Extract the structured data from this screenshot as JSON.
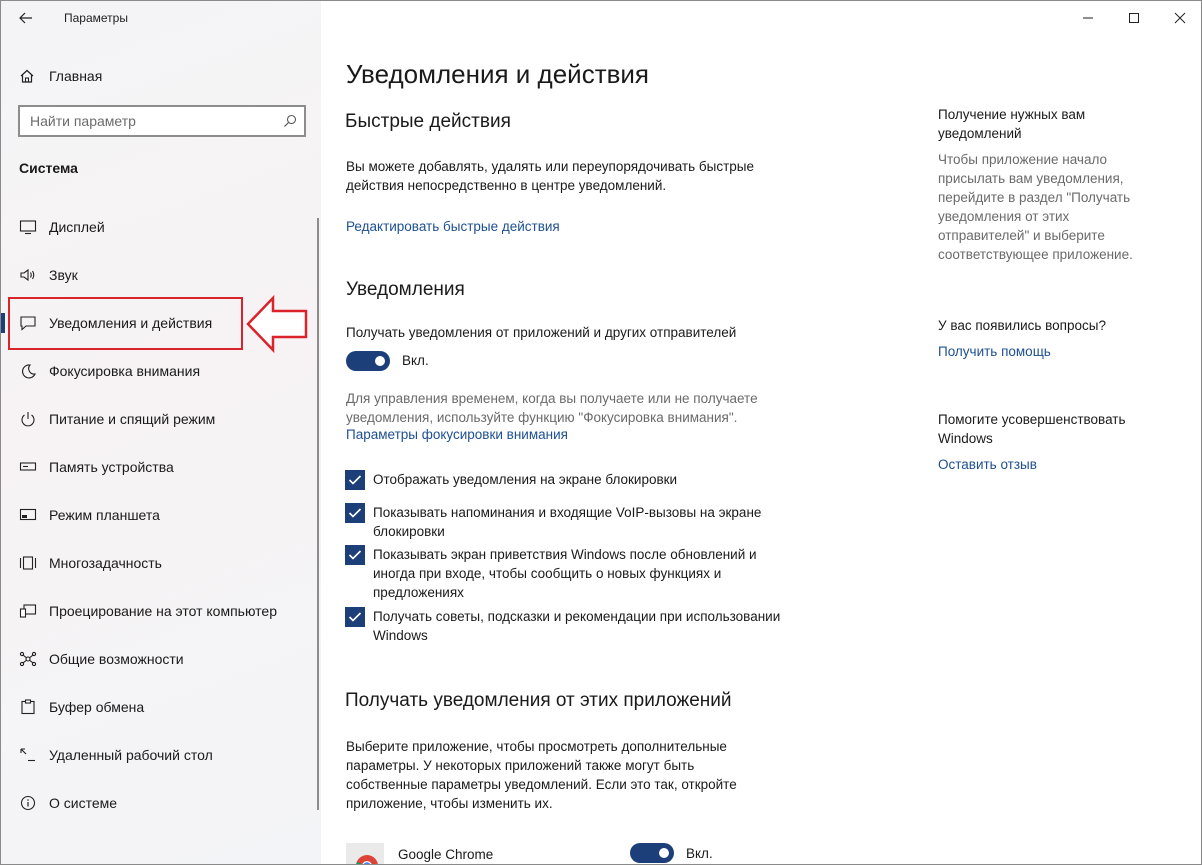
{
  "app": {
    "title": "Параметры"
  },
  "sidebar": {
    "home_label": "Главная",
    "search_placeholder": "Найти параметр",
    "section": "Система",
    "items": [
      {
        "label": "Дисплей",
        "icon": "monitor-icon"
      },
      {
        "label": "Звук",
        "icon": "speaker-icon"
      },
      {
        "label": "Уведомления и действия",
        "icon": "notification-icon",
        "active": true
      },
      {
        "label": "Фокусировка внимания",
        "icon": "moon-icon"
      },
      {
        "label": "Питание и спящий режим",
        "icon": "power-icon"
      },
      {
        "label": "Память устройства",
        "icon": "storage-icon"
      },
      {
        "label": "Режим планшета",
        "icon": "tablet-icon"
      },
      {
        "label": "Многозадачность",
        "icon": "multitask-icon"
      },
      {
        "label": "Проецирование на этот компьютер",
        "icon": "project-icon"
      },
      {
        "label": "Общие возможности",
        "icon": "shared-icon"
      },
      {
        "label": "Буфер обмена",
        "icon": "clipboard-icon"
      },
      {
        "label": "Удаленный рабочий стол",
        "icon": "remote-desktop-icon"
      },
      {
        "label": "О системе",
        "icon": "info-icon"
      }
    ]
  },
  "main": {
    "title": "Уведомления и действия",
    "quick": {
      "heading": "Быстрые действия",
      "desc": "Вы можете добавлять, удалять или переупорядочивать быстрые действия непосредственно в центре уведомлений.",
      "link": "Редактировать быстрые действия"
    },
    "notifications": {
      "heading": "Уведомления",
      "toggle_label": "Получать уведомления от приложений и других отправителей",
      "toggle_state": "Вкл.",
      "focus_desc": "Для управления временем, когда вы получаете или не получаете уведомления, используйте функцию \"Фокусировка внимания\".",
      "focus_link": "Параметры фокусировки внимания",
      "checkboxes": [
        "Отображать уведомления на экране блокировки",
        "Показывать напоминания и входящие VoIP-вызовы на экране блокировки",
        "Показывать экран приветствия Windows после обновлений и иногда при входе, чтобы сообщить о новых функциях и предложениях",
        "Получать советы, подсказки и рекомендации при использовании Windows"
      ]
    },
    "apps": {
      "heading": "Получать уведомления от этих приложений",
      "desc": "Выберите приложение, чтобы просмотреть дополнительные параметры. У некоторых приложений также могут быть собственные параметры уведомлений. Если это так, откройте приложение, чтобы изменить их.",
      "rows": [
        {
          "name": "Google Chrome",
          "state": "Вкл."
        }
      ]
    }
  },
  "right": {
    "get_heading": "Получение нужных вам уведомлений",
    "get_desc": "Чтобы приложение начало присылать вам уведомления, перейдите в раздел \"Получать уведомления от этих отправителей\" и выберите соответствующее приложение.",
    "questions": "У вас появились вопросы?",
    "help_link": "Получить помощь",
    "improve": "Помогите усовершенствовать Windows",
    "feedback_link": "Оставить отзыв"
  },
  "colors": {
    "accent": "#1c3f7a",
    "link": "#1d4f91",
    "highlight": "#d9242b"
  }
}
